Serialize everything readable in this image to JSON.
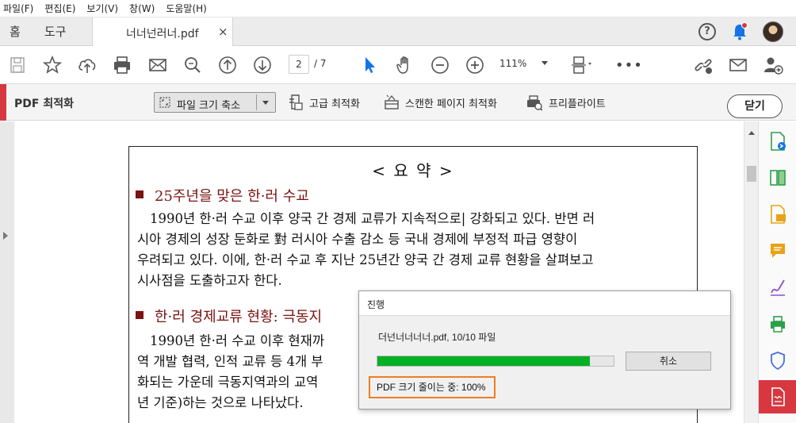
{
  "menu": [
    "파일(F)",
    "편집(E)",
    "보기(V)",
    "창(W)",
    "도움말(H)"
  ],
  "tabs": {
    "home": "홈",
    "tools": "도구",
    "doc": "너너넌러너.pdf",
    "doc_close": "×"
  },
  "toolbar": {
    "page_current": "2",
    "page_total": "/ 7",
    "zoom": "111%",
    "more": "•••"
  },
  "optimize": {
    "title": "PDF 최적화",
    "reduce_label": "파일 크기 축소",
    "advanced": "고급 최적화",
    "scanned": "스캔한 페이지 최적화",
    "preflight": "프리플라이트",
    "close": "닫기"
  },
  "document": {
    "title": "< 요       약 >",
    "section1_heading": "25주년을 맞은 한·러 수교",
    "section1_lines": [
      "1990년 한·러 수교 이후 양국 간 경제 교류가 지속적으로| 강화되고 있다. 반면 러",
      "시아 경제의 성장 둔화로 對 러시아 수출 감소 등 국내 경제에 부정적 파급 영향이",
      "우려되고 있다. 이에, 한·러 수교 후 지난 25년간 양국 간 경제 교류 현황을 살펴보고",
      "시사점을 도출하고자 한다."
    ],
    "section2_heading": "한·러 경제교류 현황: 극동지",
    "section2_lines": [
      "1990년 한·러 수교 이후 현재까",
      "역 개발 협력, 인적 교류 등 4개 부",
      "화되는 가운데 극동지역과의 교역",
      "년 기준)하는 것으로 나타났다."
    ]
  },
  "dialog": {
    "caption": "진행",
    "file_status": "더넌너너너너.pdf, 10/10 파일",
    "cancel": "취소",
    "status": "PDF 크기 줄이는 중: 100%",
    "progress_fraction": 0.9,
    "progress_color": "#06b025",
    "highlight_color": "#ef7d22"
  },
  "colors": {
    "accent": "#d7373f",
    "heading": "#7a1212",
    "rail_icon": "#2d9f4a"
  }
}
